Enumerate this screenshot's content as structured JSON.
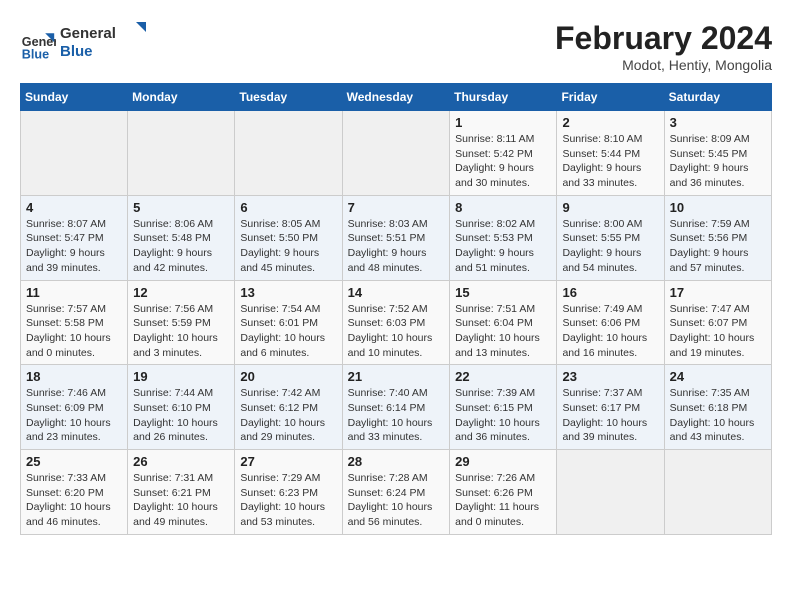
{
  "logo": {
    "text_general": "General",
    "text_blue": "Blue"
  },
  "title": "February 2024",
  "location": "Modot, Hentiy, Mongolia",
  "days_of_week": [
    "Sunday",
    "Monday",
    "Tuesday",
    "Wednesday",
    "Thursday",
    "Friday",
    "Saturday"
  ],
  "weeks": [
    [
      {
        "day": "",
        "info": ""
      },
      {
        "day": "",
        "info": ""
      },
      {
        "day": "",
        "info": ""
      },
      {
        "day": "",
        "info": ""
      },
      {
        "day": "1",
        "info": "Sunrise: 8:11 AM\nSunset: 5:42 PM\nDaylight: 9 hours and 30 minutes."
      },
      {
        "day": "2",
        "info": "Sunrise: 8:10 AM\nSunset: 5:44 PM\nDaylight: 9 hours and 33 minutes."
      },
      {
        "day": "3",
        "info": "Sunrise: 8:09 AM\nSunset: 5:45 PM\nDaylight: 9 hours and 36 minutes."
      }
    ],
    [
      {
        "day": "4",
        "info": "Sunrise: 8:07 AM\nSunset: 5:47 PM\nDaylight: 9 hours and 39 minutes."
      },
      {
        "day": "5",
        "info": "Sunrise: 8:06 AM\nSunset: 5:48 PM\nDaylight: 9 hours and 42 minutes."
      },
      {
        "day": "6",
        "info": "Sunrise: 8:05 AM\nSunset: 5:50 PM\nDaylight: 9 hours and 45 minutes."
      },
      {
        "day": "7",
        "info": "Sunrise: 8:03 AM\nSunset: 5:51 PM\nDaylight: 9 hours and 48 minutes."
      },
      {
        "day": "8",
        "info": "Sunrise: 8:02 AM\nSunset: 5:53 PM\nDaylight: 9 hours and 51 minutes."
      },
      {
        "day": "9",
        "info": "Sunrise: 8:00 AM\nSunset: 5:55 PM\nDaylight: 9 hours and 54 minutes."
      },
      {
        "day": "10",
        "info": "Sunrise: 7:59 AM\nSunset: 5:56 PM\nDaylight: 9 hours and 57 minutes."
      }
    ],
    [
      {
        "day": "11",
        "info": "Sunrise: 7:57 AM\nSunset: 5:58 PM\nDaylight: 10 hours and 0 minutes."
      },
      {
        "day": "12",
        "info": "Sunrise: 7:56 AM\nSunset: 5:59 PM\nDaylight: 10 hours and 3 minutes."
      },
      {
        "day": "13",
        "info": "Sunrise: 7:54 AM\nSunset: 6:01 PM\nDaylight: 10 hours and 6 minutes."
      },
      {
        "day": "14",
        "info": "Sunrise: 7:52 AM\nSunset: 6:03 PM\nDaylight: 10 hours and 10 minutes."
      },
      {
        "day": "15",
        "info": "Sunrise: 7:51 AM\nSunset: 6:04 PM\nDaylight: 10 hours and 13 minutes."
      },
      {
        "day": "16",
        "info": "Sunrise: 7:49 AM\nSunset: 6:06 PM\nDaylight: 10 hours and 16 minutes."
      },
      {
        "day": "17",
        "info": "Sunrise: 7:47 AM\nSunset: 6:07 PM\nDaylight: 10 hours and 19 minutes."
      }
    ],
    [
      {
        "day": "18",
        "info": "Sunrise: 7:46 AM\nSunset: 6:09 PM\nDaylight: 10 hours and 23 minutes."
      },
      {
        "day": "19",
        "info": "Sunrise: 7:44 AM\nSunset: 6:10 PM\nDaylight: 10 hours and 26 minutes."
      },
      {
        "day": "20",
        "info": "Sunrise: 7:42 AM\nSunset: 6:12 PM\nDaylight: 10 hours and 29 minutes."
      },
      {
        "day": "21",
        "info": "Sunrise: 7:40 AM\nSunset: 6:14 PM\nDaylight: 10 hours and 33 minutes."
      },
      {
        "day": "22",
        "info": "Sunrise: 7:39 AM\nSunset: 6:15 PM\nDaylight: 10 hours and 36 minutes."
      },
      {
        "day": "23",
        "info": "Sunrise: 7:37 AM\nSunset: 6:17 PM\nDaylight: 10 hours and 39 minutes."
      },
      {
        "day": "24",
        "info": "Sunrise: 7:35 AM\nSunset: 6:18 PM\nDaylight: 10 hours and 43 minutes."
      }
    ],
    [
      {
        "day": "25",
        "info": "Sunrise: 7:33 AM\nSunset: 6:20 PM\nDaylight: 10 hours and 46 minutes."
      },
      {
        "day": "26",
        "info": "Sunrise: 7:31 AM\nSunset: 6:21 PM\nDaylight: 10 hours and 49 minutes."
      },
      {
        "day": "27",
        "info": "Sunrise: 7:29 AM\nSunset: 6:23 PM\nDaylight: 10 hours and 53 minutes."
      },
      {
        "day": "28",
        "info": "Sunrise: 7:28 AM\nSunset: 6:24 PM\nDaylight: 10 hours and 56 minutes."
      },
      {
        "day": "29",
        "info": "Sunrise: 7:26 AM\nSunset: 6:26 PM\nDaylight: 11 hours and 0 minutes."
      },
      {
        "day": "",
        "info": ""
      },
      {
        "day": "",
        "info": ""
      }
    ]
  ]
}
